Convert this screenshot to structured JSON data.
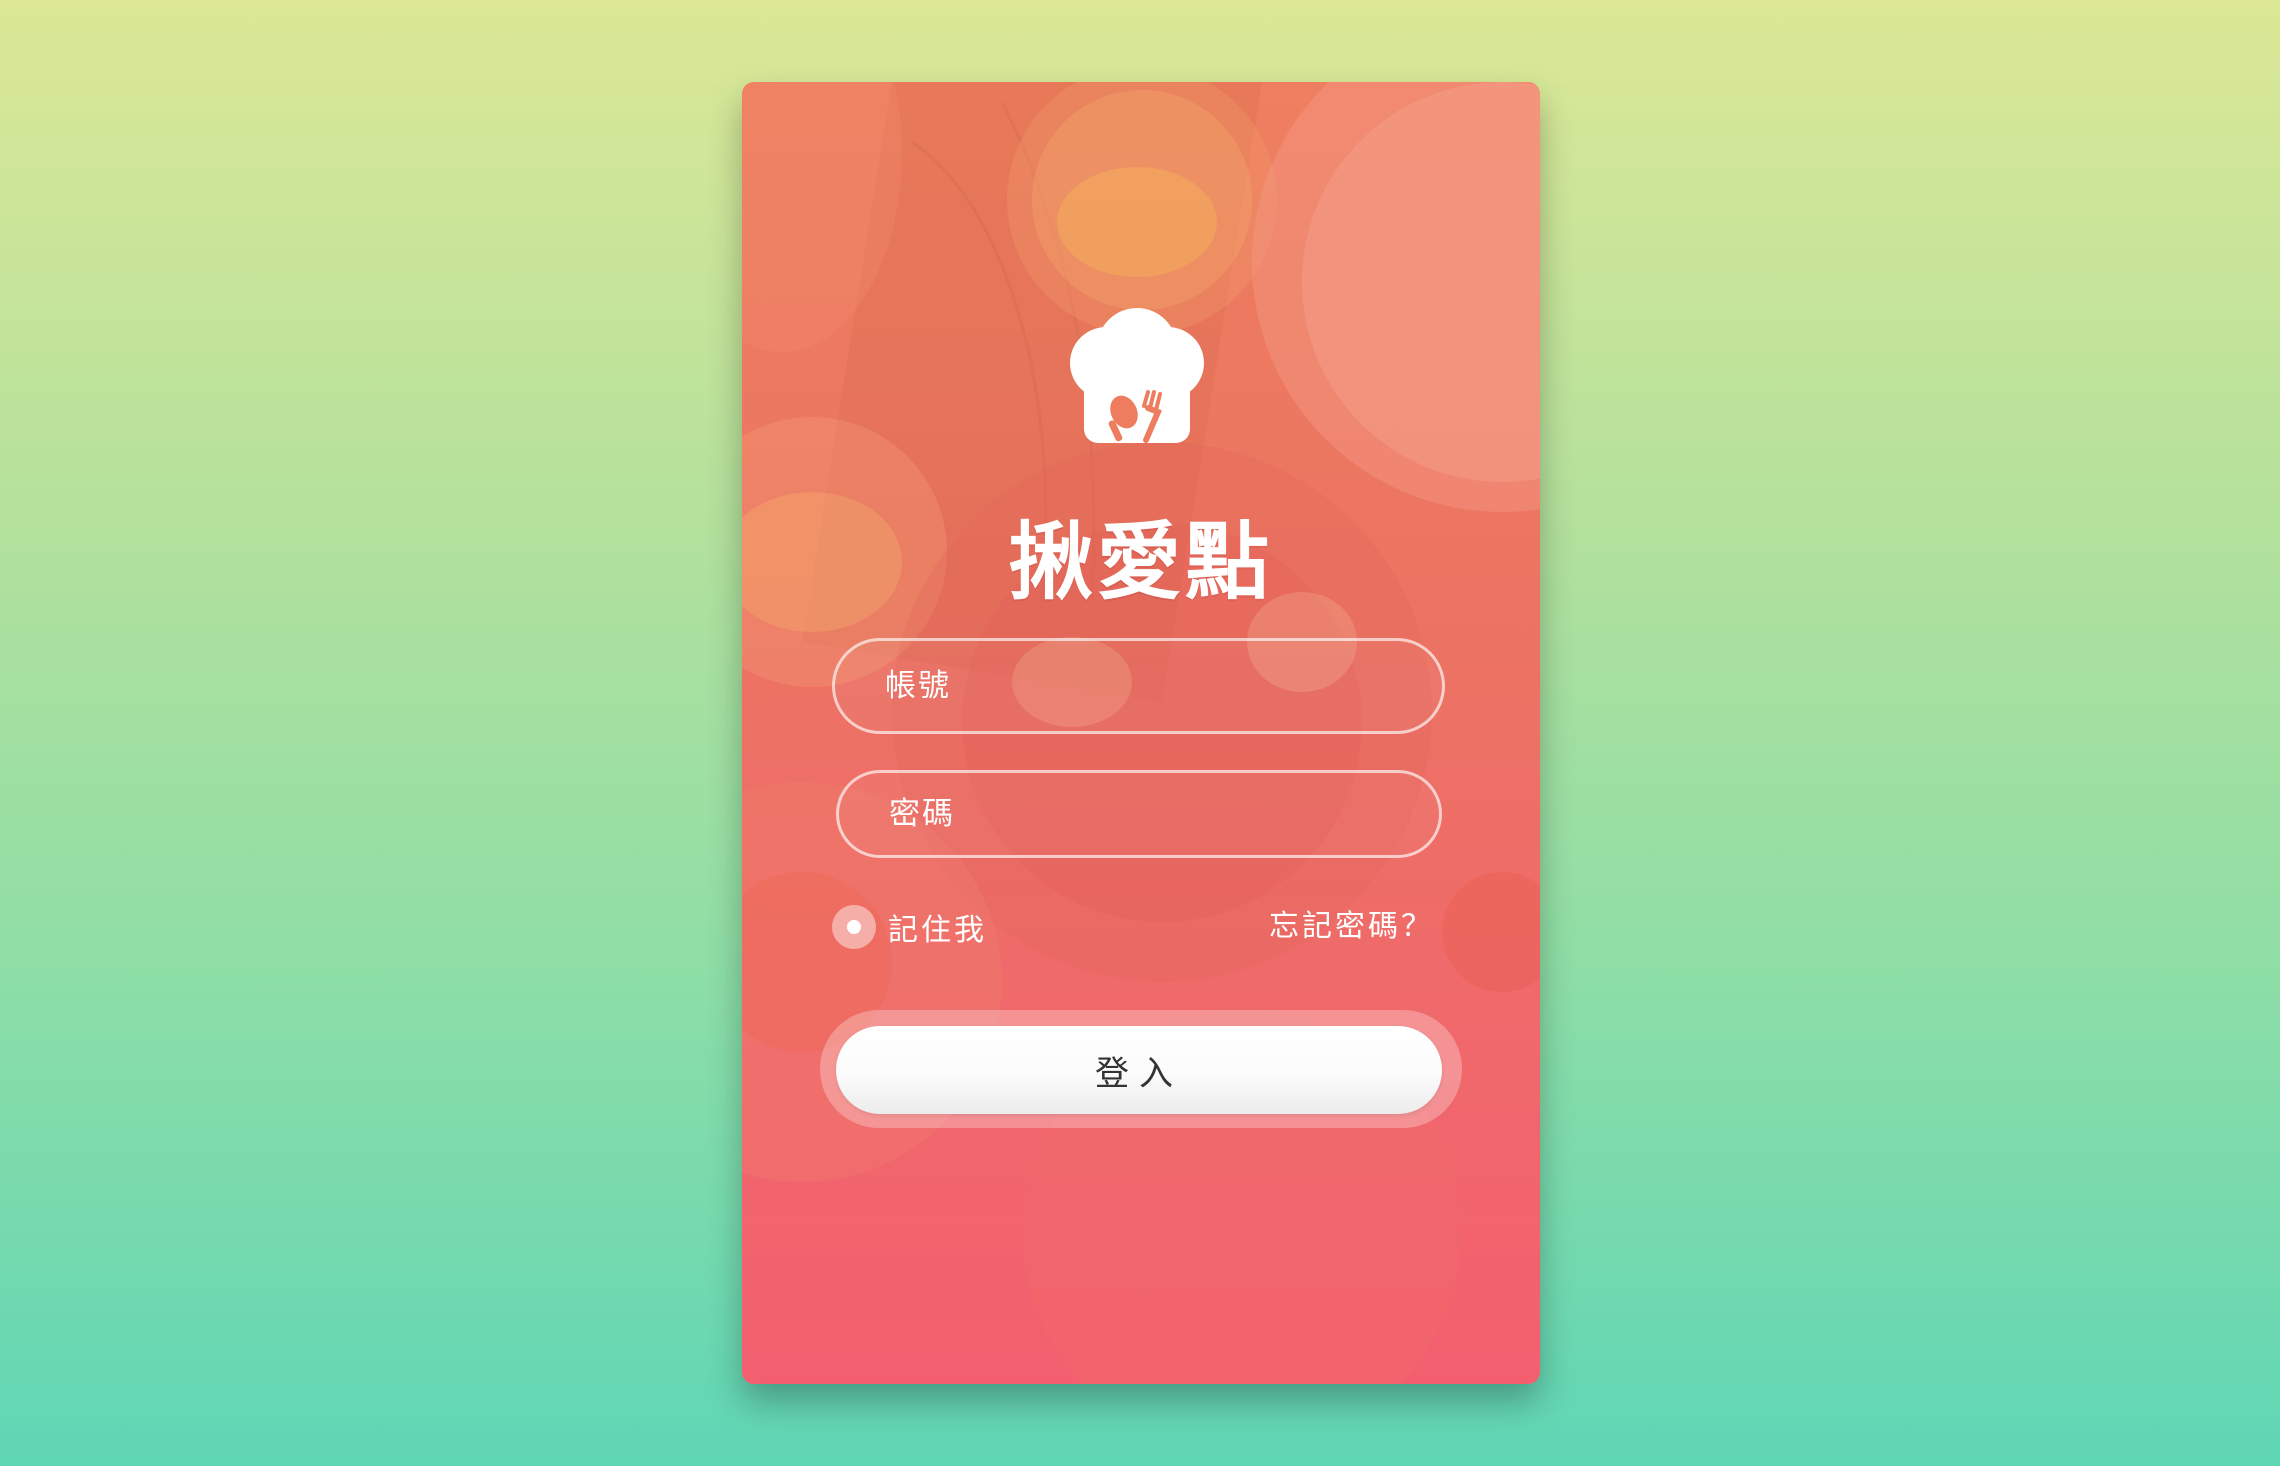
{
  "app": {
    "brand_name": "揪愛點",
    "logo_icon": "chef-hat-with-spoon-and-fork-icon"
  },
  "form": {
    "account_placeholder": "帳號",
    "account_value": "",
    "password_placeholder": "密碼",
    "password_value": "",
    "remember_label": "記住我",
    "remember_checked": true,
    "forgot_label": "忘記密碼？",
    "login_label": "登入"
  },
  "colors": {
    "background_top": "#dce896",
    "background_bottom": "#5fd6b5",
    "card_top": "#ee7f5f",
    "card_bottom": "#f35f6f",
    "button_text": "#333333"
  }
}
